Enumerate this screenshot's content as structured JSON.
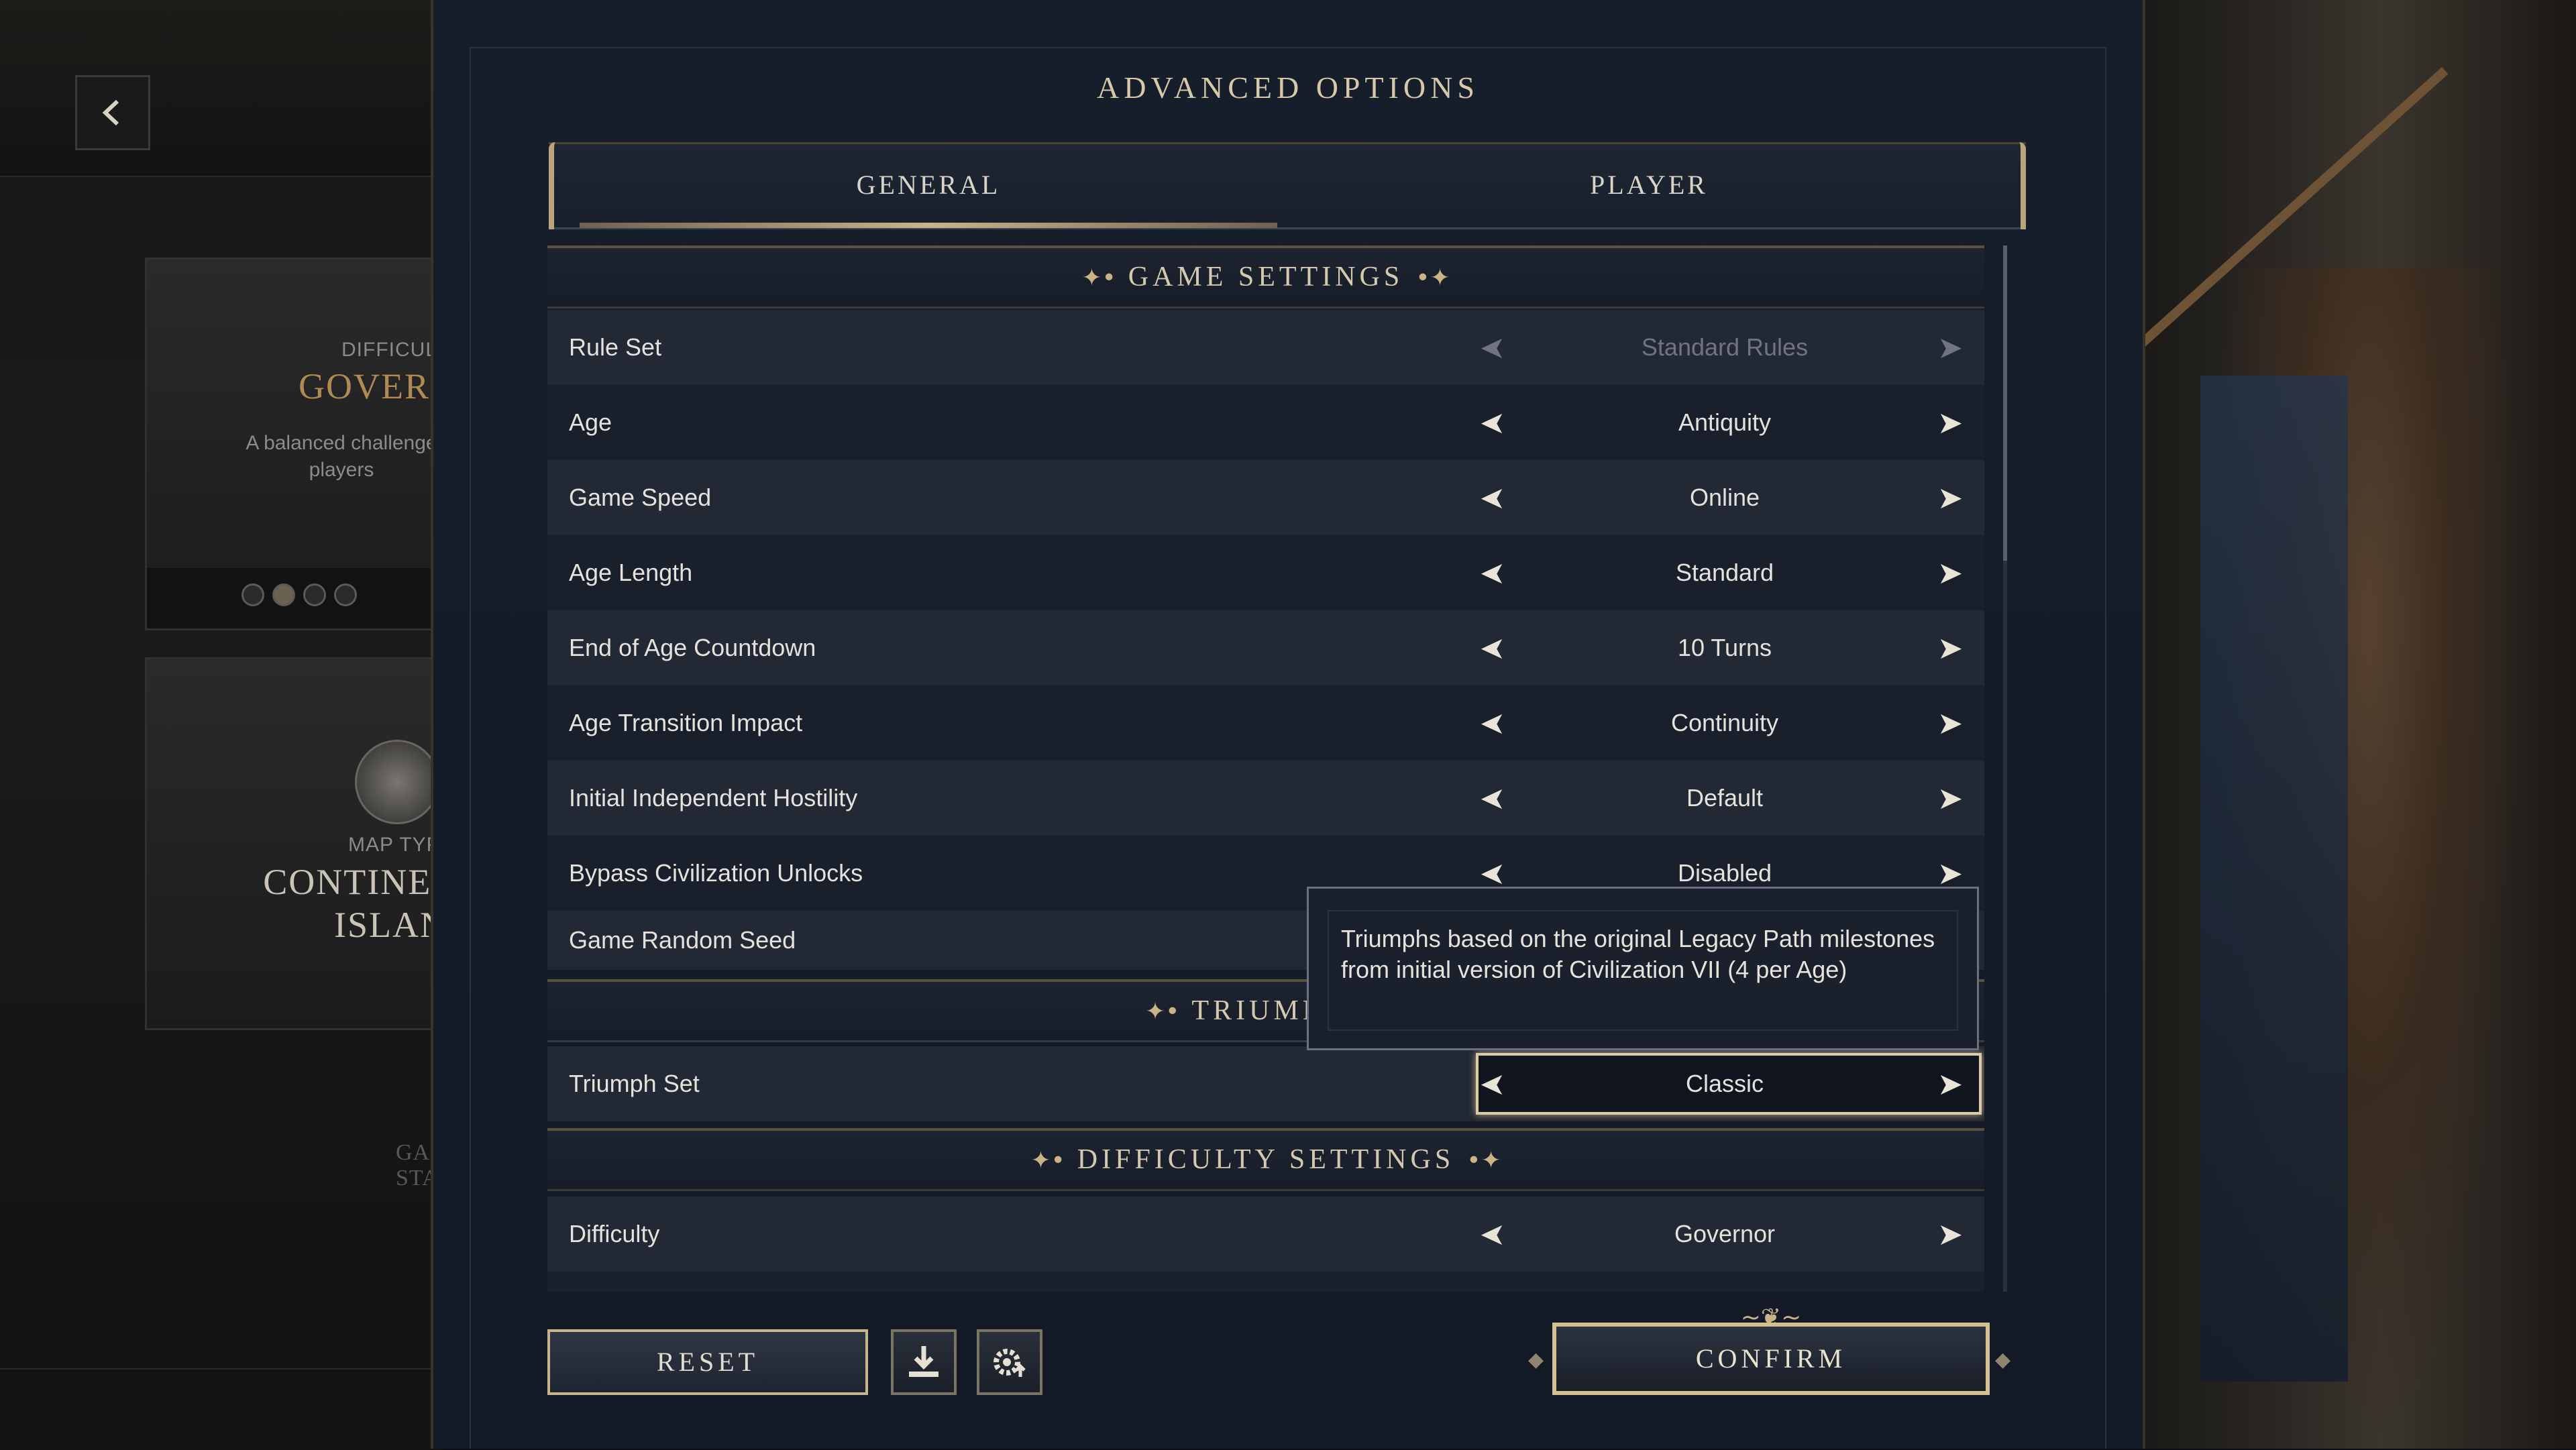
{
  "background_left": {
    "card1": {
      "label": "DIFFICUL",
      "title": "GOVER",
      "description": "A balanced challenge\nplayers"
    },
    "card2": {
      "label": "MAP TYP",
      "title": "CONTINENTS AN\nISLANDS"
    },
    "footer_label": "GAME STAR"
  },
  "dialog": {
    "title": "ADVANCED OPTIONS",
    "tabs": [
      {
        "label": "GENERAL",
        "active": true
      },
      {
        "label": "PLAYER",
        "active": false
      }
    ],
    "sections": {
      "game_settings": "GAME SETTINGS",
      "triumph_settings": "TRIUMPH SE",
      "difficulty_settings": "DIFFICULTY SETTINGS"
    },
    "rows": [
      {
        "name": "Rule Set",
        "value": "Standard Rules",
        "enabled": false
      },
      {
        "name": "Age",
        "value": "Antiquity"
      },
      {
        "name": "Game Speed",
        "value": "Online"
      },
      {
        "name": "Age Length",
        "value": "Standard"
      },
      {
        "name": "End of Age Countdown",
        "value": "10 Turns"
      },
      {
        "name": "Age Transition Impact",
        "value": "Continuity"
      },
      {
        "name": "Initial Independent Hostility",
        "value": "Default"
      },
      {
        "name": "Bypass Civilization Unlocks",
        "value": "Disabled"
      },
      {
        "name": "Game Random Seed",
        "value": ""
      },
      {
        "name": "Triumph Set",
        "value": "Classic",
        "focused": true
      },
      {
        "name": "Difficulty",
        "value": "Governor"
      }
    ],
    "tooltip": "Triumphs based on the original Legacy Path milestones from initial version of Civilization VII (4 per Age)",
    "buttons": {
      "reset": "RESET",
      "confirm": "CONFIRM",
      "save_icon": "download-icon",
      "load_icon": "gear-upload-icon"
    },
    "colors": {
      "accent_gold": "#c8b58c",
      "panel_bg": "#171e2b",
      "row_light": "#222834",
      "row_dark": "#1a202b"
    }
  }
}
